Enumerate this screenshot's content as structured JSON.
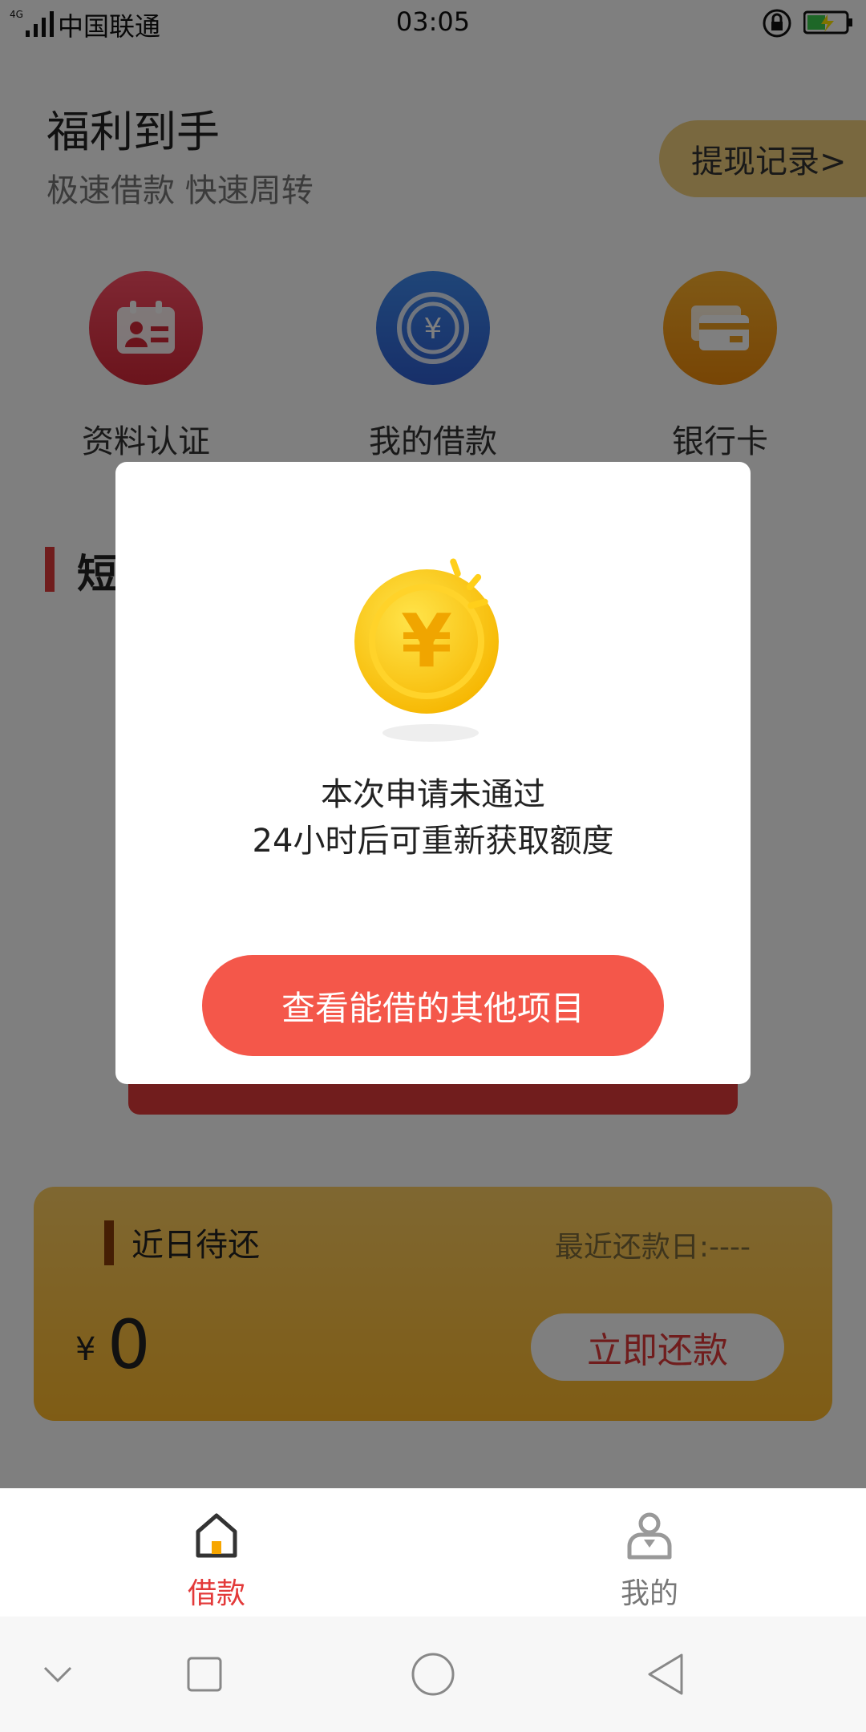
{
  "status_bar": {
    "network": "4G",
    "carrier": "中国联通",
    "time": "03:05"
  },
  "header": {
    "title": "福利到手",
    "subtitle": "极速借款 快速周转",
    "withdraw_record_label": "提现记录>"
  },
  "quick_entries": [
    {
      "label": "资料认证",
      "icon": "id-card-icon",
      "color": "#e0283c"
    },
    {
      "label": "我的借款",
      "icon": "yen-coin-icon",
      "color": "#2f63d6"
    },
    {
      "label": "银行卡",
      "icon": "bank-card-icon",
      "color": "#f08b0a"
    }
  ],
  "section": {
    "title": "短"
  },
  "repayment": {
    "title": "近日待还",
    "due_date_label": "最近还款日:----",
    "currency": "¥",
    "amount": "0",
    "repay_button": "立即还款"
  },
  "tabs": [
    {
      "label": "借款",
      "icon": "home-icon",
      "active": true
    },
    {
      "label": "我的",
      "icon": "user-icon",
      "active": false
    }
  ],
  "modal": {
    "message_line1": "本次申请未通过",
    "message_line2": "24小时后可重新获取额度",
    "button_label": "查看能借的其他项目"
  },
  "colors": {
    "accent_red": "#e33a3a",
    "modal_button": "#f4574a",
    "gold": "#ffb92a"
  }
}
